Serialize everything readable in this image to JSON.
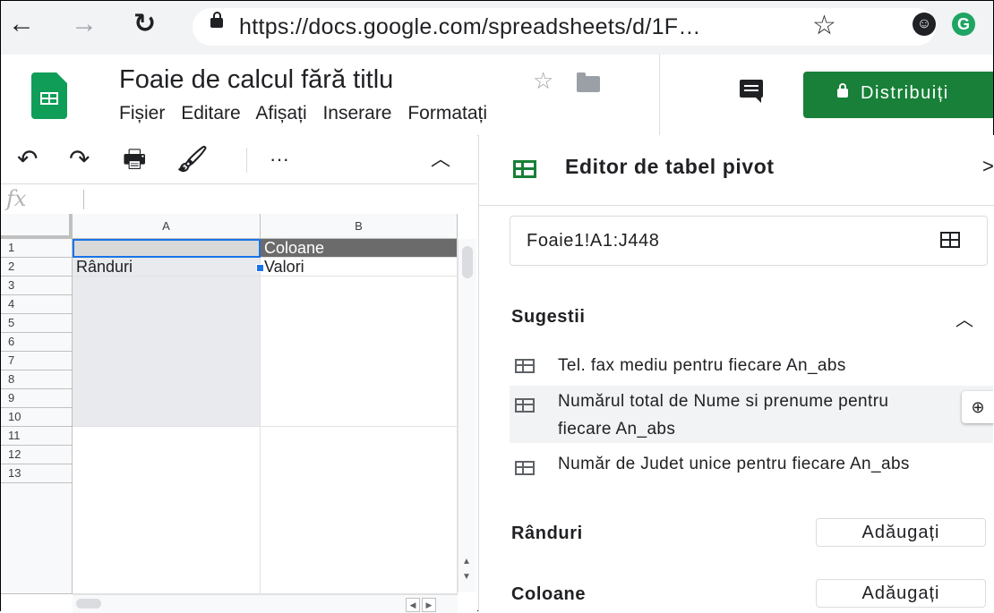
{
  "browser": {
    "url": "https://docs.google.com/spreadsheets/d/1F…",
    "back_icon": "arrow-left",
    "forward_icon": "arrow-right",
    "reload_icon": "reload"
  },
  "header": {
    "title": "Foaie de calcul fără titlu",
    "menus": [
      "Fișier",
      "Editare",
      "Afișați",
      "Inserare",
      "Formatați"
    ],
    "share_label": "Distribuiți",
    "brand_color": "#188038"
  },
  "formula": {
    "fx": "fx",
    "value": ""
  },
  "grid": {
    "columns": [
      "A",
      "B"
    ],
    "rows": [
      "1",
      "2",
      "3",
      "4",
      "5",
      "6",
      "7",
      "8",
      "9",
      "10",
      "11",
      "12",
      "13"
    ],
    "cells": {
      "B1": "Coloane",
      "A2": "Rânduri",
      "B2": "Valori"
    }
  },
  "pivot": {
    "title": "Editor de tabel pivot",
    "close": ">",
    "range": "Foaie1!A1:J448",
    "suggestions_title": "Sugestii",
    "suggestions": [
      "Tel. fax mediu pentru fiecare An_abs",
      "Numărul total de Nume si prenume pentru fiecare An_abs",
      "Număr de Judet unice pentru fiecare An_abs"
    ],
    "rows_label": "Rânduri",
    "columns_label": "Coloane",
    "add_label": "Adăugați"
  }
}
